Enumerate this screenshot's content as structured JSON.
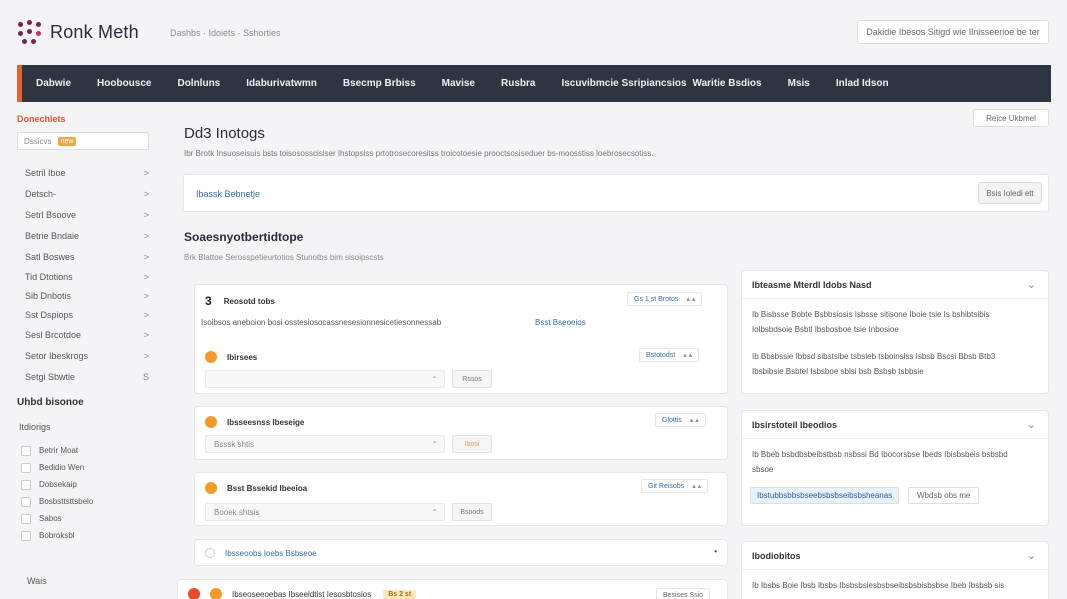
{
  "header": {
    "brand": "Ronk Meth",
    "breadcrumb": "Dashbs · Idoiets · Sshorties",
    "top_button": "Dakidie Ibesos Sitigd wie Ilnisseerioe be ter"
  },
  "nav": {
    "items": [
      "Dabwie",
      "Hoobousce",
      "Dolnluns",
      "Idaburivatwmn",
      "Bsecmp Brbiss",
      "Mavise",
      "Rusbra",
      "Iscuvibmcie Ssripiancsios",
      "Waritie Bsdios",
      "Msis",
      "Inlad Idson"
    ]
  },
  "sidebar": {
    "title": "Donechiets",
    "search_value": "Dssicvs",
    "search_tag": "new",
    "items": [
      "Setril Iboe",
      "Detsch-",
      "Setrl Bsoove",
      "Betrie Bndaie",
      "Satl Boswes",
      "Tid Dtotions",
      "Sib Dnbotis",
      "Sst Dspiops",
      "Sesl Brcotdoe",
      "Setor Ibeskrogs",
      "Setgi Sbwtie"
    ],
    "item_marks": [
      ">",
      ">",
      ">",
      ">",
      ">",
      ">",
      ">",
      ">",
      ">",
      ">",
      "S"
    ],
    "heading": "Uhbd bisonoe",
    "sub_heading": "Itdiorigs",
    "checks": [
      "Betrir Moat",
      "Bedidio Wen",
      "Dobsekaip",
      "Bosbsttsttsbelo",
      "Sabos",
      "Bobroksbl"
    ],
    "footer": "Wais"
  },
  "main": {
    "right_button": "Reice Ukbmel",
    "title": "Dd3 Inotogs",
    "description": "Ibr Brotk Insuoseisuis bsts toisososscisiser Ihstopsiss prtotrosecoresitss troicotoesie prooctsosiseduer bs-moosstiss loebrosecsotiss.",
    "banner_link": "Ibassk Bebnetje",
    "banner_button": "Bsis Ioledi ett",
    "section_title": "Soaesnyotbertidtope",
    "section_desc": "Brk Blattoe Serosspetieurtotios Stunotbs bim sisoipscsts",
    "cards": [
      {
        "num": "3",
        "title": "Reosotd tobs",
        "pill": "Gs 1 st Brotos",
        "text": "Isoibsos aneboion bosi osstesiosocassnesesionnesicetiesonnessab",
        "link": "Bsst Bseoeios"
      },
      {
        "title": "Ibirsees",
        "pill": "Bstotodst",
        "field": "",
        "button": "Rssos"
      },
      {
        "title": "Ibsseesnss Ibeseige",
        "pill": "Glottis",
        "field": "Bsssk shtis",
        "button": "Ibosi"
      },
      {
        "title": "Bsst Bssekid Ibeeioa",
        "pill": "Git Reisobs",
        "field": "Booek shtsis",
        "button": "Bsoods"
      },
      {
        "title": "Ibsseoobs Ioebs Bsbseoe"
      },
      {
        "title": "Ibseoseeoebas Ibseeldtist Iesosbtosios",
        "badge": "Bs 2 st",
        "pill": "Besises Ssio"
      }
    ]
  },
  "right": {
    "panels": [
      {
        "title": "Ibteasme Mterdl Idobs Nasd",
        "lines": [
          "Ib Bisbsse Bobte Bsbbsiosis Isbsse sitisone Iboie tsie Is bshibtsibis",
          "Iolbsbdsoie Bsbtl Ibsbosboe tsie Inbosioe",
          "Ib Bbsbssie Ibbsd sibstsibe tsbsleb tsboinslss Isbsb Bscsi Bbsb Btb3",
          "Ibsbibsie Bsbtel Isbsboe sblsi bsb Bsbsb tsbbsie"
        ]
      },
      {
        "title": "Ibsirstoteil Ibeodios",
        "lines": [
          "Ib Bbeb bsbdbsbeibstbsb nsbssi Bd Ibocorsbse Ibeds Ibisbsbeis bsbsbd",
          "sbsoe"
        ],
        "link": "Ibstubbsbbsbseebsbsbseibsbsheanas",
        "button": "Wbdsb obs me"
      },
      {
        "title": "Ibodiobitos",
        "lines": [
          "Ib Ibsbs Boie Ibsb Ibsbs Ibsbsbsiesbsbseibsbsbisbsbse Ibeb Ibsbsb sis"
        ]
      }
    ]
  }
}
